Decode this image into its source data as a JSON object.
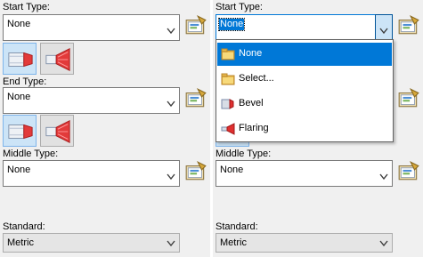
{
  "left_panel": {
    "start_type": {
      "label": "Start Type:",
      "value": "None"
    },
    "end_type": {
      "label": "End Type:",
      "value": "None"
    },
    "middle_type": {
      "label": "Middle Type:",
      "value": "None"
    },
    "standard": {
      "label": "Standard:",
      "value": "Metric"
    }
  },
  "right_panel": {
    "start_type": {
      "label": "Start Type:",
      "value": "None"
    },
    "middle_type": {
      "label": "Middle Type:",
      "value": "None"
    },
    "standard": {
      "label": "Standard:",
      "value": "Metric"
    },
    "dropdown_options": [
      {
        "label": "None",
        "icon": "folder-icon"
      },
      {
        "label": "Select...",
        "icon": "folder-icon"
      },
      {
        "label": "Bevel",
        "icon": "bevel-icon"
      },
      {
        "label": "Flaring",
        "icon": "flaring-icon"
      }
    ]
  },
  "colors": {
    "accent": "#0078d7",
    "highlight_text": "#ffffff",
    "panel_bg": "#f0f0f0"
  }
}
